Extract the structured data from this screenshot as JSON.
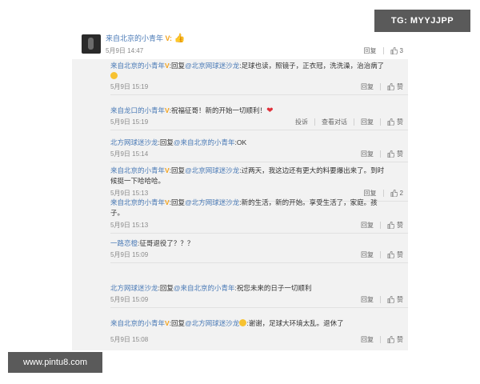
{
  "watermark_tg": "TG: MYYJJPP",
  "watermark_site": "www.pintu8.com",
  "top_comment": {
    "user": "来自北京的小青年",
    "badge": "V:",
    "emoji_icon": "thumbs-up-emoji",
    "time": "5月9日 14:47",
    "reply_label": "回复",
    "likes": "3"
  },
  "replies": [
    {
      "user": "来自北京的小青年",
      "badge": "V",
      "text_before": ":回复",
      "mention": "@北京网球迷沙龙",
      "text_after": ":足球也读，照镜子，正衣冠，洗洗澡，治治病了",
      "emoji": "smile",
      "time": "5月9日 15:19",
      "actions": [
        "回复",
        "赞"
      ],
      "likes": ""
    },
    {
      "user": "来自龙口的小青年",
      "badge": "V",
      "text_before": ":祝福征哥！新的开始一切顺利！",
      "mention": "",
      "text_after": "",
      "emoji": "heart",
      "time": "5月9日 15:19",
      "actions": [
        "投诉",
        "查看对话",
        "回复",
        "赞"
      ],
      "likes": ""
    },
    {
      "user": "北方网球迷沙龙",
      "badge": "",
      "text_before": ":回复",
      "mention": "@来自北京的小青年",
      "text_after": ":OK",
      "emoji": "",
      "time": "5月9日 15:14",
      "actions": [
        "回复",
        "赞"
      ],
      "likes": ""
    },
    {
      "user": "来自北京的小青年",
      "badge": "V",
      "text_before": ":回复",
      "mention": "@北京网球迷沙龙",
      "text_after": ":过两天，我这边还有更大的料要爆出来了。到时候挺一下哈哈哈。",
      "emoji": "",
      "time": "5月9日 15:13",
      "actions": [
        "回复",
        "赞"
      ],
      "likes": "2"
    },
    {
      "user": "来自北京的小青年",
      "badge": "V",
      "text_before": ":回复",
      "mention": "@北方网球迷沙龙",
      "text_after": ":新的生活，新的开始。享受生活了，家庭。孩子。",
      "emoji": "",
      "time": "5月9日 15:13",
      "actions": [
        "回复",
        "赞"
      ],
      "likes": ""
    },
    {
      "user": "一路恋橙",
      "badge": "",
      "text_before": ":征哥退役了？？？",
      "mention": "",
      "text_after": "",
      "emoji": "",
      "time": "5月9日 15:09",
      "actions": [
        "回复",
        "赞"
      ],
      "likes": ""
    },
    {
      "user": "北方网球迷沙龙",
      "badge": "",
      "text_before": ":回复",
      "mention": "@来自北京的小青年",
      "text_after": ":祝您未来的日子一切顺利",
      "emoji": "",
      "time": "5月9日 15:09",
      "actions": [
        "回复",
        "赞"
      ],
      "likes": ""
    },
    {
      "user": "来自北京的小青年",
      "badge": "V",
      "text_before": ":回复",
      "mention": "@北方网球迷沙龙",
      "text_after": ":谢谢，足球大环境太乱。退休了",
      "emoji": "smile-before",
      "time": "5月9日 15:08",
      "actions": [
        "回复",
        "赞"
      ],
      "likes": ""
    }
  ],
  "colors": {
    "link": "#4a7ab6",
    "verified": "#f2a11a",
    "heart": "#e0303a"
  }
}
